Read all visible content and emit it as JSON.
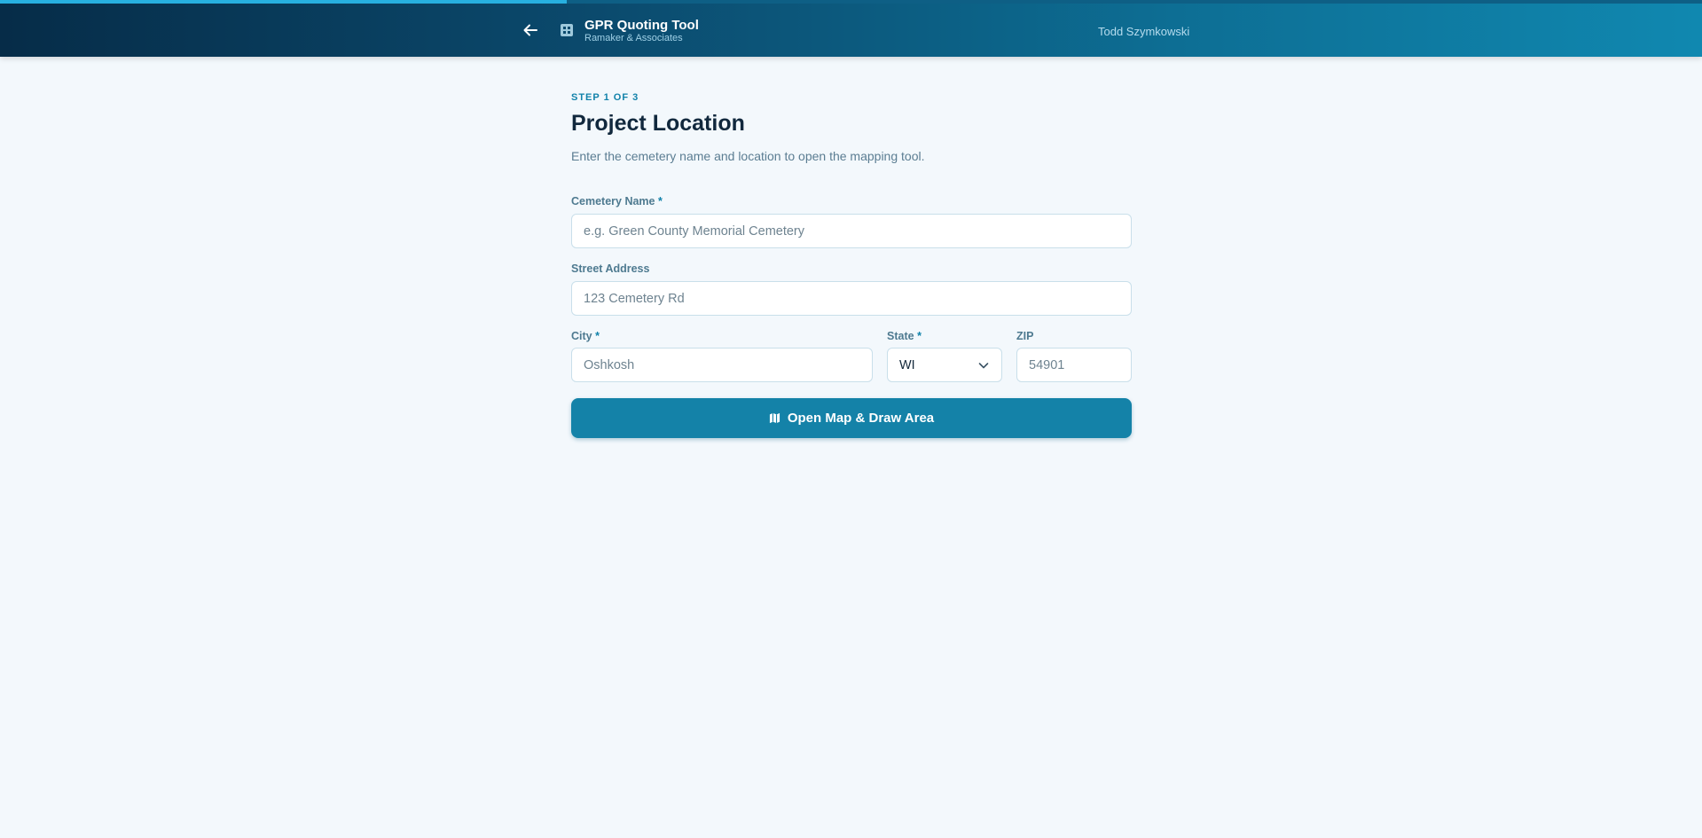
{
  "progress": {
    "fraction": 0.333
  },
  "header": {
    "back_icon": "arrow-left-icon",
    "app_icon": "building-icon",
    "title": "GPR Quoting Tool",
    "subtitle": "Ramaker & Associates",
    "user_name": "Todd Szymkowski"
  },
  "step": {
    "label": "STEP 1 OF 3",
    "title": "Project Location",
    "description": "Enter the cemetery name and location to open the mapping tool."
  },
  "form": {
    "cemetery_name": {
      "label": "Cemetery Name",
      "required_mark": "*",
      "value": "",
      "placeholder": "e.g. Green County Memorial Cemetery"
    },
    "street_address": {
      "label": "Street Address",
      "value": "",
      "placeholder": "123 Cemetery Rd"
    },
    "city": {
      "label": "City",
      "required_mark": "*",
      "value": "",
      "placeholder": "Oshkosh"
    },
    "state": {
      "label": "State",
      "required_mark": "*",
      "selected": "WI"
    },
    "zip": {
      "label": "ZIP",
      "value": "",
      "placeholder": "54901"
    }
  },
  "actions": {
    "open_map_label": "Open Map & Draw Area",
    "open_map_icon": "map-icon"
  },
  "colors": {
    "accent": "#1482a8",
    "progress": "#27b0e0",
    "title": "#11283d",
    "background": "#f3f8fc"
  }
}
